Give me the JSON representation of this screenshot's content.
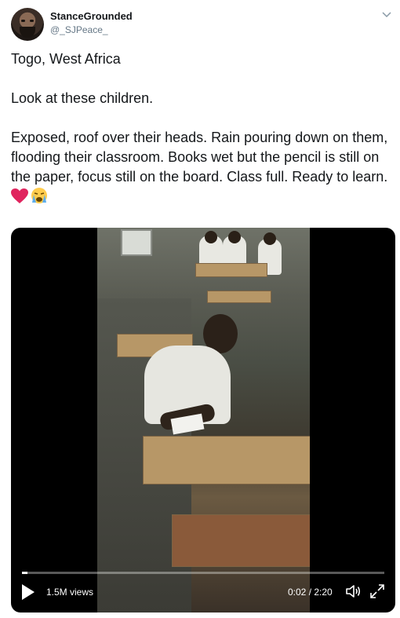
{
  "user": {
    "display_name": "StanceGrounded",
    "handle": "@_SJPeace_"
  },
  "tweet": {
    "text": "Togo, West Africa\n\nLook at these children.\n\nExposed, roof over their heads. Rain pouring down on them, flooding their classroom. Books wet but the pencil is still on the paper, focus still on the board. Class full. Ready to learn. ",
    "emojis": [
      "red-heart-icon",
      "crying-face-icon"
    ]
  },
  "video": {
    "views": "1.5M views",
    "time": "0:02 / 2:20",
    "progress": 0.015,
    "icons": [
      "play-icon",
      "volume-icon",
      "fullscreen-icon"
    ]
  },
  "colors": {
    "text": "#14171a",
    "muted": "#657786",
    "video_bg": "#000000",
    "heart": "#e0245e"
  }
}
